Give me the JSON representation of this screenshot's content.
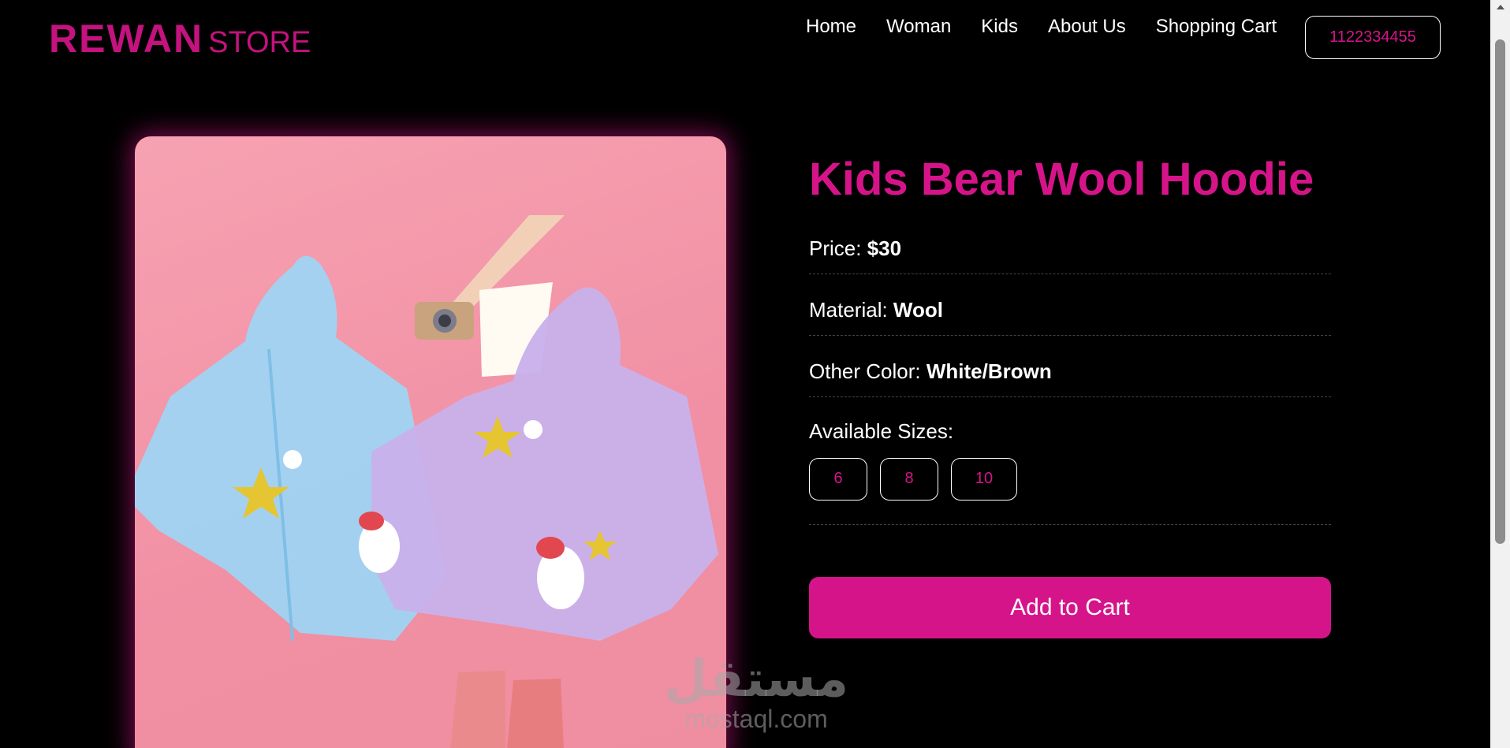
{
  "header": {
    "brand_main": "REWAN",
    "brand_sub": "STORE",
    "nav": [
      "Home",
      "Woman",
      "Kids",
      "About Us",
      "Shopping Cart"
    ],
    "phone": "1122334455"
  },
  "product": {
    "title": "Kids Bear Wool Hoodie",
    "price_label": "Price: ",
    "price_value": "$30",
    "material_label": "Material: ",
    "material_value": "Wool",
    "color_label": "Other Color: ",
    "color_value": "White/Brown",
    "sizes_label": "Available Sizes:",
    "sizes": [
      "6",
      "8",
      "10"
    ],
    "add_to_cart": "Add to Cart"
  },
  "watermark": {
    "arabic": "مستقل",
    "latin": "mostaql.com"
  },
  "colors": {
    "accent": "#d6148a",
    "background": "#000000"
  }
}
